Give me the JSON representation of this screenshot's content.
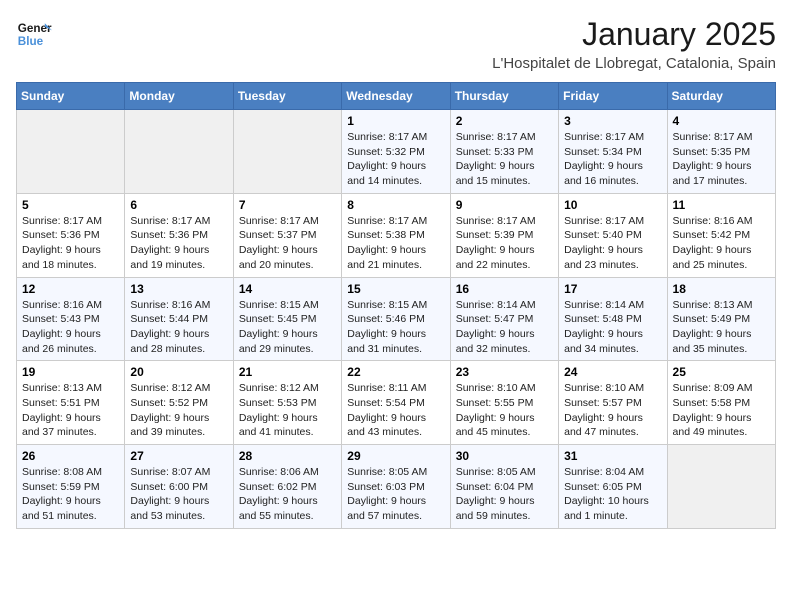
{
  "header": {
    "logo_general": "General",
    "logo_blue": "Blue",
    "title": "January 2025",
    "subtitle": "L'Hospitalet de Llobregat, Catalonia, Spain"
  },
  "weekdays": [
    "Sunday",
    "Monday",
    "Tuesday",
    "Wednesday",
    "Thursday",
    "Friday",
    "Saturday"
  ],
  "weeks": [
    [
      {
        "day": "",
        "info": ""
      },
      {
        "day": "",
        "info": ""
      },
      {
        "day": "",
        "info": ""
      },
      {
        "day": "1",
        "info": "Sunrise: 8:17 AM\nSunset: 5:32 PM\nDaylight: 9 hours\nand 14 minutes."
      },
      {
        "day": "2",
        "info": "Sunrise: 8:17 AM\nSunset: 5:33 PM\nDaylight: 9 hours\nand 15 minutes."
      },
      {
        "day": "3",
        "info": "Sunrise: 8:17 AM\nSunset: 5:34 PM\nDaylight: 9 hours\nand 16 minutes."
      },
      {
        "day": "4",
        "info": "Sunrise: 8:17 AM\nSunset: 5:35 PM\nDaylight: 9 hours\nand 17 minutes."
      }
    ],
    [
      {
        "day": "5",
        "info": "Sunrise: 8:17 AM\nSunset: 5:36 PM\nDaylight: 9 hours\nand 18 minutes."
      },
      {
        "day": "6",
        "info": "Sunrise: 8:17 AM\nSunset: 5:36 PM\nDaylight: 9 hours\nand 19 minutes."
      },
      {
        "day": "7",
        "info": "Sunrise: 8:17 AM\nSunset: 5:37 PM\nDaylight: 9 hours\nand 20 minutes."
      },
      {
        "day": "8",
        "info": "Sunrise: 8:17 AM\nSunset: 5:38 PM\nDaylight: 9 hours\nand 21 minutes."
      },
      {
        "day": "9",
        "info": "Sunrise: 8:17 AM\nSunset: 5:39 PM\nDaylight: 9 hours\nand 22 minutes."
      },
      {
        "day": "10",
        "info": "Sunrise: 8:17 AM\nSunset: 5:40 PM\nDaylight: 9 hours\nand 23 minutes."
      },
      {
        "day": "11",
        "info": "Sunrise: 8:16 AM\nSunset: 5:42 PM\nDaylight: 9 hours\nand 25 minutes."
      }
    ],
    [
      {
        "day": "12",
        "info": "Sunrise: 8:16 AM\nSunset: 5:43 PM\nDaylight: 9 hours\nand 26 minutes."
      },
      {
        "day": "13",
        "info": "Sunrise: 8:16 AM\nSunset: 5:44 PM\nDaylight: 9 hours\nand 28 minutes."
      },
      {
        "day": "14",
        "info": "Sunrise: 8:15 AM\nSunset: 5:45 PM\nDaylight: 9 hours\nand 29 minutes."
      },
      {
        "day": "15",
        "info": "Sunrise: 8:15 AM\nSunset: 5:46 PM\nDaylight: 9 hours\nand 31 minutes."
      },
      {
        "day": "16",
        "info": "Sunrise: 8:14 AM\nSunset: 5:47 PM\nDaylight: 9 hours\nand 32 minutes."
      },
      {
        "day": "17",
        "info": "Sunrise: 8:14 AM\nSunset: 5:48 PM\nDaylight: 9 hours\nand 34 minutes."
      },
      {
        "day": "18",
        "info": "Sunrise: 8:13 AM\nSunset: 5:49 PM\nDaylight: 9 hours\nand 35 minutes."
      }
    ],
    [
      {
        "day": "19",
        "info": "Sunrise: 8:13 AM\nSunset: 5:51 PM\nDaylight: 9 hours\nand 37 minutes."
      },
      {
        "day": "20",
        "info": "Sunrise: 8:12 AM\nSunset: 5:52 PM\nDaylight: 9 hours\nand 39 minutes."
      },
      {
        "day": "21",
        "info": "Sunrise: 8:12 AM\nSunset: 5:53 PM\nDaylight: 9 hours\nand 41 minutes."
      },
      {
        "day": "22",
        "info": "Sunrise: 8:11 AM\nSunset: 5:54 PM\nDaylight: 9 hours\nand 43 minutes."
      },
      {
        "day": "23",
        "info": "Sunrise: 8:10 AM\nSunset: 5:55 PM\nDaylight: 9 hours\nand 45 minutes."
      },
      {
        "day": "24",
        "info": "Sunrise: 8:10 AM\nSunset: 5:57 PM\nDaylight: 9 hours\nand 47 minutes."
      },
      {
        "day": "25",
        "info": "Sunrise: 8:09 AM\nSunset: 5:58 PM\nDaylight: 9 hours\nand 49 minutes."
      }
    ],
    [
      {
        "day": "26",
        "info": "Sunrise: 8:08 AM\nSunset: 5:59 PM\nDaylight: 9 hours\nand 51 minutes."
      },
      {
        "day": "27",
        "info": "Sunrise: 8:07 AM\nSunset: 6:00 PM\nDaylight: 9 hours\nand 53 minutes."
      },
      {
        "day": "28",
        "info": "Sunrise: 8:06 AM\nSunset: 6:02 PM\nDaylight: 9 hours\nand 55 minutes."
      },
      {
        "day": "29",
        "info": "Sunrise: 8:05 AM\nSunset: 6:03 PM\nDaylight: 9 hours\nand 57 minutes."
      },
      {
        "day": "30",
        "info": "Sunrise: 8:05 AM\nSunset: 6:04 PM\nDaylight: 9 hours\nand 59 minutes."
      },
      {
        "day": "31",
        "info": "Sunrise: 8:04 AM\nSunset: 6:05 PM\nDaylight: 10 hours\nand 1 minute."
      },
      {
        "day": "",
        "info": ""
      }
    ]
  ]
}
